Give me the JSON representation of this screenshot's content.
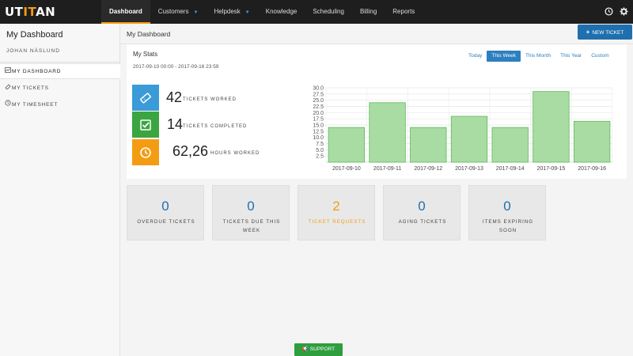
{
  "brand": {
    "logo_text": "UTITAN",
    "logo_text_main": "UT",
    "logo_text_accent": "IT",
    "logo_text_tail": "AN"
  },
  "nav": {
    "items": [
      {
        "label": "Dashboard",
        "active": true,
        "dropdown": false
      },
      {
        "label": "Customers",
        "active": false,
        "dropdown": true
      },
      {
        "label": "Helpdesk",
        "active": false,
        "dropdown": true
      },
      {
        "label": "Knowledge",
        "active": false,
        "dropdown": false
      },
      {
        "label": "Scheduling",
        "active": false,
        "dropdown": false
      },
      {
        "label": "Billing",
        "active": false,
        "dropdown": false
      },
      {
        "label": "Reports",
        "active": false,
        "dropdown": false
      }
    ],
    "icons": [
      "clock-icon",
      "gear-icon"
    ]
  },
  "sidebar": {
    "title": "My Dashboard",
    "user": "JOHAN NÄSLUND",
    "items": [
      {
        "label": "MY DASHBOARD",
        "icon": "chart-icon",
        "active": true
      },
      {
        "label": "MY TICKETS",
        "icon": "ticket-icon",
        "active": false
      },
      {
        "label": "MY TIMESHEET",
        "icon": "clock-icon",
        "active": false
      }
    ]
  },
  "header": {
    "title": "My Dashboard",
    "new_ticket_label": "NEW TICKET"
  },
  "stats": {
    "title": "My Stats",
    "range": "2017-09-10 00:00 - 2017-09-16 23:59",
    "periods": [
      {
        "label": "Today",
        "active": false
      },
      {
        "label": "This Week",
        "active": true
      },
      {
        "label": "This Month",
        "active": false
      },
      {
        "label": "This Year",
        "active": false
      },
      {
        "label": "Custom",
        "active": false
      }
    ],
    "items": [
      {
        "value": "42",
        "label": "TICKETS WORKED",
        "icon": "ticket-icon",
        "color": "#3a9bd8"
      },
      {
        "value": "14",
        "label": "TICKETS COMPLETED",
        "icon": "check-icon",
        "color": "#3aa541"
      },
      {
        "value": "62,26",
        "label": "HOURS WORKED",
        "icon": "clock-icon",
        "color": "#f39c12"
      }
    ]
  },
  "chart_data": {
    "type": "bar",
    "categories": [
      "2017-09-10",
      "2017-09-11",
      "2017-09-12",
      "2017-09-13",
      "2017-09-14",
      "2017-09-15",
      "2017-09-16"
    ],
    "values": [
      14,
      24,
      14,
      18.5,
      14,
      28.5,
      16.5
    ],
    "ylim": [
      0,
      30
    ],
    "yticks": [
      "2.5",
      "5.0",
      "7.5",
      "10.0",
      "12.5",
      "15.0",
      "17.5",
      "20.0",
      "22.5",
      "25.0",
      "27.5",
      "30.0"
    ],
    "grid": true,
    "bar_color": "#a8dca3",
    "bar_border": "#5fb85a"
  },
  "tiles": [
    {
      "value": "0",
      "label": "OVERDUE TICKETS",
      "highlight": false
    },
    {
      "value": "0",
      "label": "TICKETS DUE THIS WEEK",
      "highlight": false
    },
    {
      "value": "2",
      "label": "TICKET REQUESTS",
      "highlight": true
    },
    {
      "value": "0",
      "label": "AGING TICKETS",
      "highlight": false
    },
    {
      "value": "0",
      "label": "ITEMS EXPIRING SOON",
      "highlight": false
    }
  ],
  "support_label": "SUPPORT"
}
